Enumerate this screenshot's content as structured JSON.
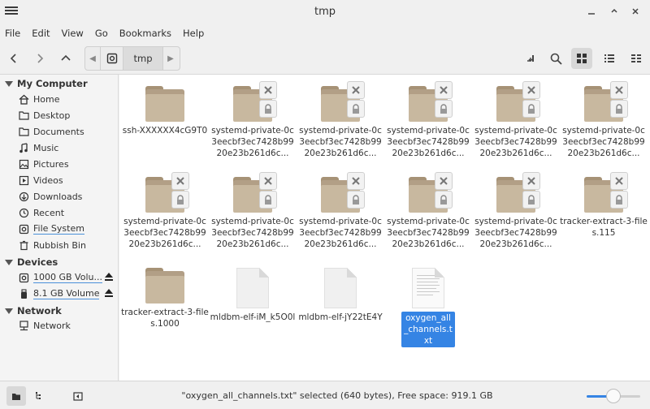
{
  "window": {
    "title": "tmp"
  },
  "menubar": [
    "File",
    "Edit",
    "View",
    "Go",
    "Bookmarks",
    "Help"
  ],
  "pathbar": {
    "current": "tmp"
  },
  "sidebar": {
    "sections": [
      {
        "label": "My Computer",
        "items": [
          {
            "label": "Home",
            "icon": "home-icon"
          },
          {
            "label": "Desktop",
            "icon": "folder-icon"
          },
          {
            "label": "Documents",
            "icon": "folder-icon"
          },
          {
            "label": "Music",
            "icon": "music-icon"
          },
          {
            "label": "Pictures",
            "icon": "image-icon"
          },
          {
            "label": "Videos",
            "icon": "video-icon"
          },
          {
            "label": "Downloads",
            "icon": "download-icon"
          },
          {
            "label": "Recent",
            "icon": "clock-icon"
          },
          {
            "label": "File System",
            "icon": "drive-icon"
          },
          {
            "label": "Rubbish Bin",
            "icon": "trash-icon"
          }
        ]
      },
      {
        "label": "Devices",
        "items": [
          {
            "label": "1000 GB Volu...",
            "icon": "drive-icon"
          },
          {
            "label": "8.1 GB Volume",
            "icon": "usb-icon"
          }
        ]
      },
      {
        "label": "Network",
        "items": [
          {
            "label": "Network",
            "icon": "network-icon"
          }
        ]
      }
    ]
  },
  "files": [
    {
      "name": "ssh-XXXXXX4cG9T0",
      "type": "folder"
    },
    {
      "name": "systemd-private-0c3eecbf3ec7428b9920e23b261d6c...",
      "type": "locked-folder"
    },
    {
      "name": "systemd-private-0c3eecbf3ec7428b9920e23b261d6c...",
      "type": "locked-folder"
    },
    {
      "name": "systemd-private-0c3eecbf3ec7428b9920e23b261d6c...",
      "type": "locked-folder"
    },
    {
      "name": "systemd-private-0c3eecbf3ec7428b9920e23b261d6c...",
      "type": "locked-folder"
    },
    {
      "name": "systemd-private-0c3eecbf3ec7428b9920e23b261d6c...",
      "type": "locked-folder"
    },
    {
      "name": "systemd-private-0c3eecbf3ec7428b9920e23b261d6c...",
      "type": "locked-folder"
    },
    {
      "name": "systemd-private-0c3eecbf3ec7428b9920e23b261d6c...",
      "type": "locked-folder"
    },
    {
      "name": "systemd-private-0c3eecbf3ec7428b9920e23b261d6c...",
      "type": "locked-folder"
    },
    {
      "name": "systemd-private-0c3eecbf3ec7428b9920e23b261d6c...",
      "type": "locked-folder"
    },
    {
      "name": "systemd-private-0c3eecbf3ec7428b9920e23b261d6c...",
      "type": "locked-folder"
    },
    {
      "name": "tracker-extract-3-files.115",
      "type": "locked-folder"
    },
    {
      "name": "tracker-extract-3-files.1000",
      "type": "folder"
    },
    {
      "name": "mldbm-elf-iM_k5O0l",
      "type": "blank-file"
    },
    {
      "name": "mldbm-elf-jY22tE4Y",
      "type": "blank-file"
    },
    {
      "name": "oxygen_all_channels.txt",
      "type": "text-file",
      "selected": true
    }
  ],
  "status": {
    "text": "\"oxygen_all_channels.txt\" selected (640 bytes), Free space: 919.1 GB"
  },
  "zoom": {
    "level": 0.5
  },
  "colors": {
    "accent": "#3584e4",
    "folder": "#c8b89f"
  }
}
